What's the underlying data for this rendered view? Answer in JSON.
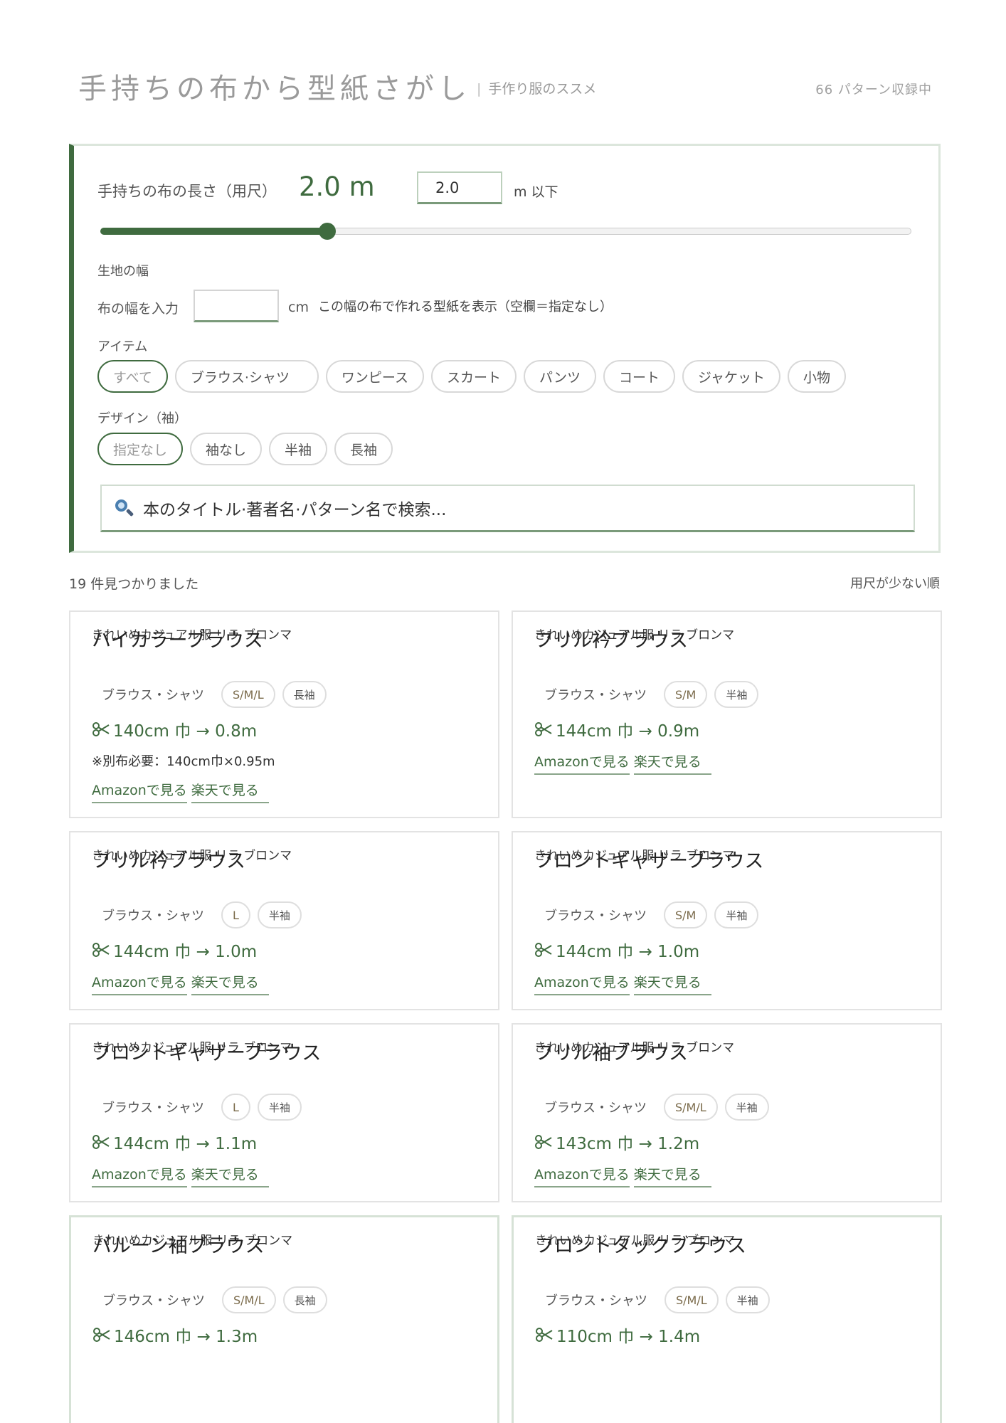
{
  "header": {
    "title": "手持ちの布から型紙さがし",
    "subtitle": "手作り服のススメ",
    "count": "66 パターン収録中"
  },
  "search_panel": {
    "length_label": "手持ちの布の長さ（用尺）",
    "length_display": "2.0 m",
    "length_value": "2.0",
    "length_unit": "m 以下",
    "slider_fraction": 0.28,
    "width_section_label": "生地の幅",
    "width_label": "布の幅を入力",
    "width_value": "",
    "width_unit": "cm",
    "width_note": "この幅の布で作れる型紙を表示（空欄＝指定なし）",
    "item_section_label": "アイテム",
    "items": [
      "すべて",
      "ブラウス·シャツ",
      "ワンピース",
      "スカート",
      "パンツ",
      "コート",
      "ジャケット",
      "小物"
    ],
    "design_section_label": "デザイン（袖）",
    "designs": [
      "指定なし",
      "袖なし",
      "半袖",
      "長袖"
    ],
    "search_placeholder": "本のタイトル·著者名·パターン名で検索..."
  },
  "results": {
    "count_text": "19 件見つかりました",
    "sort_text": "用尺が少ない順",
    "cards": [
      {
        "meta": "きれいめカジュアル服 リラ ブロンマ",
        "title": "ハイカラーブラウス",
        "category": "ブラウス・シャツ",
        "size": "S/M/L",
        "sleeve": "長袖",
        "requirement": "140cm 巾 →  0.8m",
        "extra": "※別布必要：140cm巾×0.95m",
        "amazon": "Amazonで見る",
        "rakuten": "楽天で見る"
      },
      {
        "meta": "きれいめカジュアル服 リラ ブロンマ",
        "title": "フリル衿ブラウス",
        "category": "ブラウス・シャツ",
        "size": "S/M",
        "sleeve": "半袖",
        "requirement": "144cm 巾 →  0.9m",
        "amazon": "Amazonで見る",
        "rakuten": "楽天で見る"
      },
      {
        "meta": "きれいめカジュアル服 リラ ブロンマ",
        "title": "フリル衿ブラウス",
        "category": "ブラウス・シャツ",
        "size": "L",
        "sleeve": "半袖",
        "requirement": "144cm 巾 →  1.0m",
        "amazon": "Amazonで見る",
        "rakuten": "楽天で見る"
      },
      {
        "meta": "きれいめカジュアル服 リラ ブロンマ",
        "title": "フロントギャザーブラウス",
        "category": "ブラウス・シャツ",
        "size": "S/M",
        "sleeve": "半袖",
        "requirement": "144cm 巾 →  1.0m",
        "amazon": "Amazonで見る",
        "rakuten": "楽天で見る"
      },
      {
        "meta": "きれいめカジュアル服 リラ ブロンマ",
        "title": "フロントギャザーブラウス",
        "category": "ブラウス・シャツ",
        "size": "L",
        "sleeve": "半袖",
        "requirement": "144cm 巾 →  1.1m",
        "amazon": "Amazonで見る",
        "rakuten": "楽天で見る"
      },
      {
        "meta": "きれいめカジュアル服 リラ ブロンマ",
        "title": "フリル袖ブラウス",
        "category": "ブラウス・シャツ",
        "size": "S/M/L",
        "sleeve": "半袖",
        "requirement": "143cm 巾 →  1.2m",
        "amazon": "Amazonで見る",
        "rakuten": "楽天で見る"
      },
      {
        "meta": "きれいめカジュアル服 リラ ブロンマ",
        "title": "バルーン袖ブラウス",
        "category": "ブラウス・シャツ",
        "size": "S/M/L",
        "sleeve": "長袖",
        "requirement": "146cm 巾 →  1.3m"
      },
      {
        "meta": "きれいめカジュアル服 リラ ブロンマ",
        "title": "フロントタックブラウス",
        "category": "ブラウス・シャツ",
        "size": "S/M/L",
        "sleeve": "半袖",
        "requirement": "110cm 巾 →  1.4m"
      }
    ]
  },
  "colors": {
    "accent": "#3f6b3f",
    "border": "#e3e3e3",
    "panel_border": "#dce6dc",
    "search_icon": "#4a7fb0"
  },
  "icons": {
    "search": "magnifier-icon",
    "scissors": "scissors-icon"
  }
}
